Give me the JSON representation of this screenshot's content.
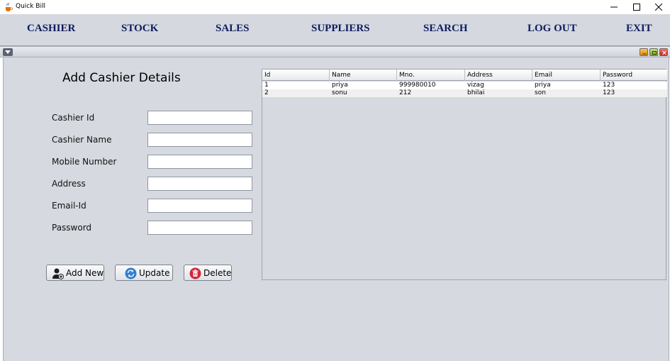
{
  "window": {
    "title": "Quick Bill",
    "controls": [
      "minimize-icon",
      "maximize-icon",
      "close-icon"
    ]
  },
  "menu": {
    "items": [
      {
        "label": "CASHIER"
      },
      {
        "label": "STOCK"
      },
      {
        "label": "SALES"
      },
      {
        "label": "SUPPLIERS"
      },
      {
        "label": "SEARCH"
      },
      {
        "label": "LOG OUT"
      },
      {
        "label": "EXIT"
      }
    ],
    "color": "#0e1b5f"
  },
  "form": {
    "heading": "Add Cashier Details",
    "fields": [
      {
        "label": "Cashier Id",
        "value": ""
      },
      {
        "label": "Cashier Name",
        "value": ""
      },
      {
        "label": "Mobile Number",
        "value": ""
      },
      {
        "label": "Address",
        "value": ""
      },
      {
        "label": "Email-Id",
        "value": ""
      },
      {
        "label": "Password",
        "value": ""
      }
    ],
    "buttons": [
      {
        "label": "Add New",
        "icon": "add-user-icon"
      },
      {
        "label": "Update",
        "icon": "refresh-icon"
      },
      {
        "label": "Delete",
        "icon": "trash-icon"
      }
    ]
  },
  "table": {
    "columns": [
      "Id",
      "Name",
      "Mno.",
      "Address",
      "Email",
      "Password"
    ],
    "rows": [
      [
        "1",
        "priya",
        "999980010",
        "vizag",
        "priya",
        "123"
      ],
      [
        "2",
        "sonu",
        "212",
        "bhilai",
        "son",
        "123"
      ]
    ]
  }
}
